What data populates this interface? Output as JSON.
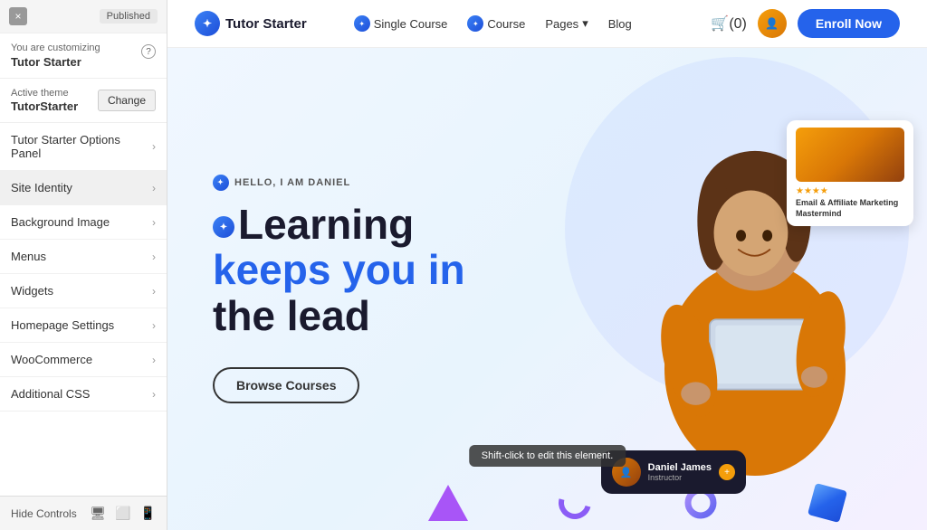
{
  "panel": {
    "status": "Published",
    "close_label": "×",
    "customizing_label": "You are customizing",
    "customizing_name": "Tutor Starter",
    "help_icon": "?",
    "theme_label": "Active theme",
    "theme_name": "TutorStarter",
    "change_button": "Change",
    "menu_items": [
      {
        "id": "tutor-options",
        "label": "Tutor Starter Options Panel"
      },
      {
        "id": "site-identity",
        "label": "Site Identity"
      },
      {
        "id": "background-image",
        "label": "Background Image"
      },
      {
        "id": "menus",
        "label": "Menus"
      },
      {
        "id": "widgets",
        "label": "Widgets"
      },
      {
        "id": "homepage-settings",
        "label": "Homepage Settings"
      },
      {
        "id": "woocommerce",
        "label": "WooCommerce"
      },
      {
        "id": "additional-css",
        "label": "Additional CSS"
      }
    ],
    "footer": {
      "hide_controls": "Hide Controls",
      "desktop_icon": "🖥",
      "tablet_icon": "⬜",
      "mobile_icon": "📱"
    }
  },
  "navbar": {
    "logo_text": "Tutor Starter",
    "links": [
      {
        "label": "Single Course",
        "has_icon": true
      },
      {
        "label": "Course",
        "has_icon": true
      },
      {
        "label": "Pages",
        "has_icon": true,
        "has_dropdown": true
      },
      {
        "label": "Blog",
        "has_icon": true
      }
    ],
    "cart_label": "(0)",
    "enroll_button": "Enroll Now"
  },
  "hero": {
    "subtitle": "HELLO, I AM DANIEL",
    "title_line1": "Learning",
    "title_line2": "keeps you in",
    "title_line3": "the lead",
    "browse_button": "Browse Courses",
    "course_card": {
      "stars": "★★★★",
      "title": "Email & Affiliate\nMarketing Mastermind"
    },
    "instructor_card": {
      "name": "Daniel James",
      "role": "Instructor"
    },
    "tooltip": "Shift-click to edit this element."
  },
  "decorations": {
    "shapes": [
      "triangle",
      "hook",
      "ring",
      "cube"
    ]
  }
}
